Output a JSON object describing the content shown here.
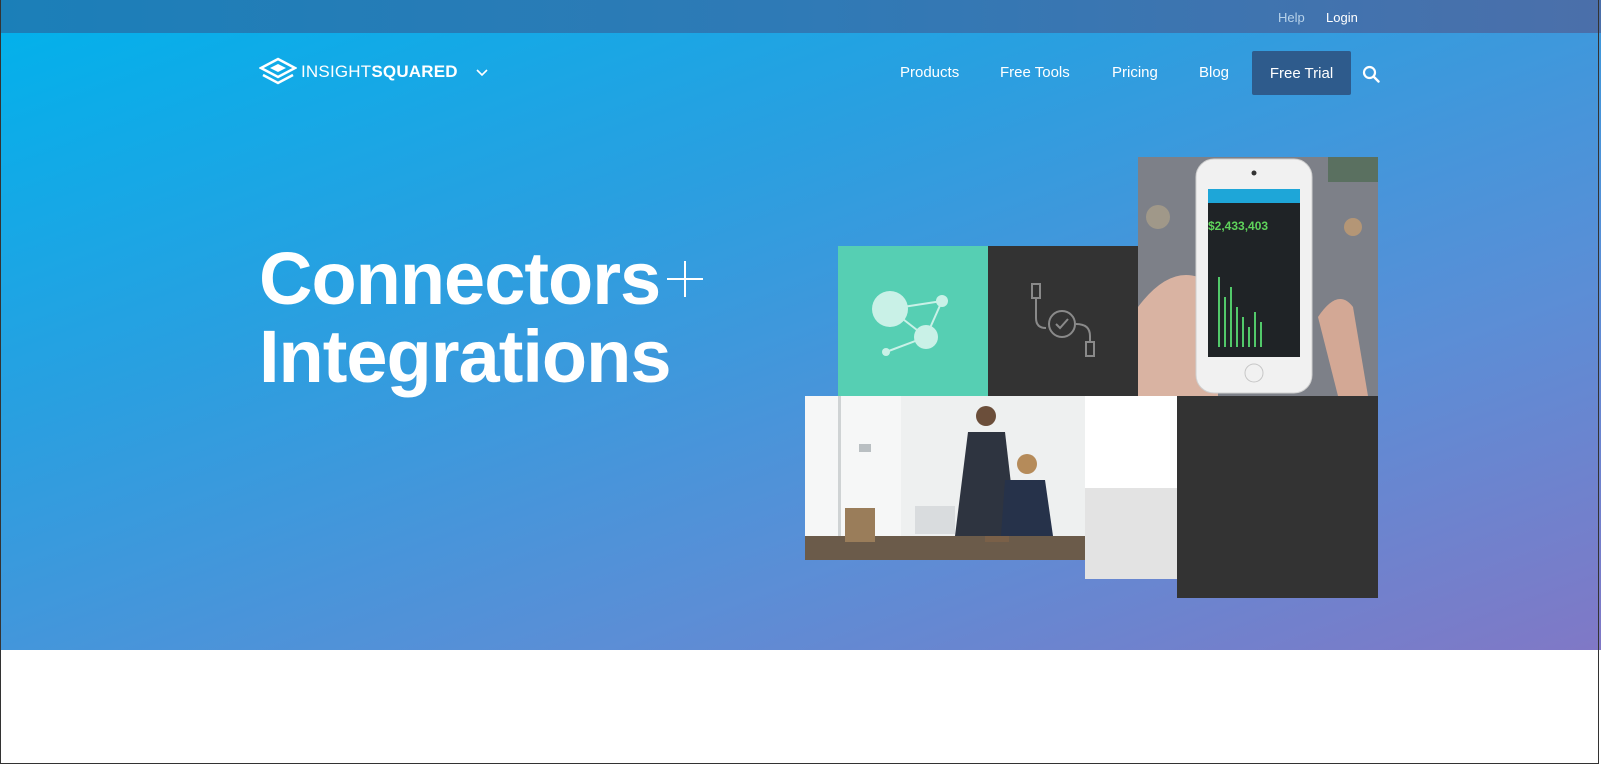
{
  "topbar": {
    "help_label": "Help",
    "login_label": "Login"
  },
  "brand": {
    "name_light": "INSIGHT",
    "name_bold": "SQUARED"
  },
  "nav": {
    "items": [
      {
        "label": "Products"
      },
      {
        "label": "Free Tools"
      },
      {
        "label": "Pricing"
      },
      {
        "label": "Blog"
      }
    ],
    "cta_label": "Free Trial"
  },
  "hero": {
    "headline_line1": "Connectors",
    "headline_line2": "Integrations"
  },
  "phone_screen": {
    "amount": "$2,433,403"
  },
  "colors": {
    "gradient_start": "#00b2ec",
    "gradient_end": "#8078c6",
    "cta_bg": "#2e5b8c",
    "teal_tile": "#56cfb3",
    "dark_tile": "#333333"
  },
  "icons": [
    "logo-diamond-icon",
    "chevron-down-icon",
    "search-icon",
    "plus-icon",
    "network-nodes-icon",
    "cable-check-icon"
  ]
}
